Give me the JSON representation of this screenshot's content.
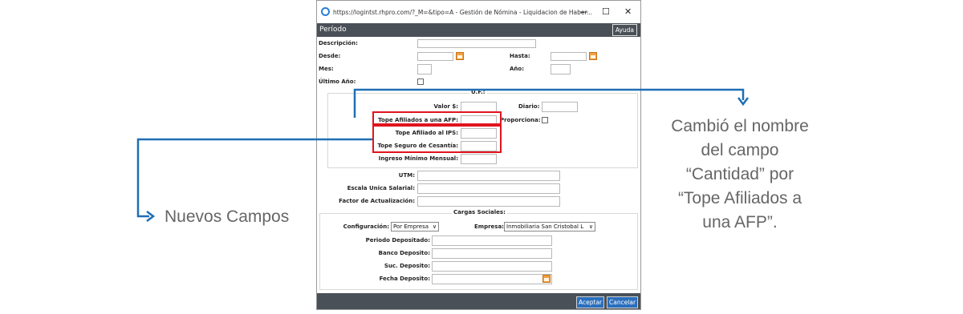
{
  "window": {
    "title": "https://logintst.rhpro.com/?_M=&tipo=A - Gestión de Nómina - Liquidacion de Haber...",
    "minimize": "—",
    "maximize": "☐",
    "close": "✕"
  },
  "header": {
    "title": "Período",
    "help_label": "Ayuda"
  },
  "form": {
    "descripcion_label": "Descripción:",
    "desde_label": "Desde:",
    "hasta_label": "Hasta:",
    "mes_label": "Mes:",
    "anio_label": "Año:",
    "ultimo_anio_label": "Último Año:",
    "uf_section": "U.F.:",
    "valor_label": "Valor $:",
    "diario_label": "Diario:",
    "tope_afp_label": "Tope Afiliados a una AFP:",
    "proporciona_label": "Proporciona:",
    "tope_ips_label": "Tope Afiliado al IPS:",
    "tope_cesantia_label": "Tope Seguro de Cesantía:",
    "ingreso_minimo_label": "Ingreso Mínimo Mensual:",
    "utm_label": "UTM:",
    "escala_label": "Escala Unica Salarial:",
    "factor_label": "Factor de Actualización:",
    "cargas_section": "Cargas Sociales:",
    "configuracion_label": "Configuración:",
    "configuracion_value": "Por Empresa",
    "empresa_label": "Empresa:",
    "empresa_value": "Inmobiliaria San Cristobal L",
    "periodo_depositado_label": "Periodo Depositado:",
    "banco_label": "Banco Deposito:",
    "suc_label": "Suc. Deposito:",
    "fecha_label": "Fecha Deposito:"
  },
  "footer": {
    "accept_label": "Aceptar",
    "cancel_label": "Cancelar"
  },
  "annotations": {
    "left_text": "Nuevos Campos",
    "right_lines": [
      "Cambió el nombre",
      "del campo",
      "“Cantidad” por",
      "“Tope Afiliados a",
      "una AFP”."
    ]
  },
  "colors": {
    "arrow": "#1f6fb5",
    "highlight": "#e0141e",
    "header_bg": "#4a5058",
    "button_bg": "#2b6fbd"
  }
}
